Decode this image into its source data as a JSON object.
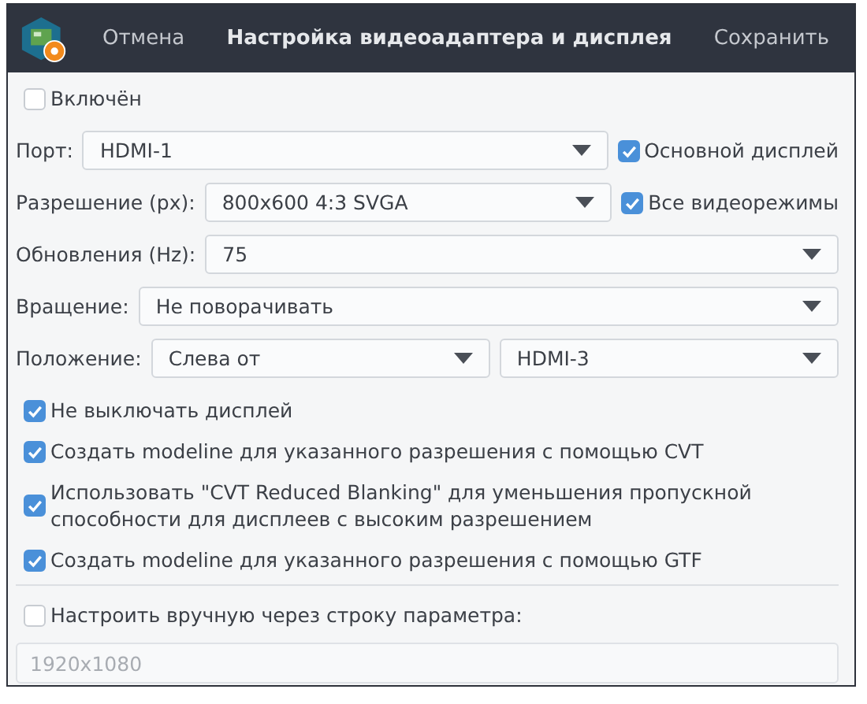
{
  "header": {
    "cancel": "Отмена",
    "title": "Настройка видеоадаптера и дисплея",
    "save": "Сохранить"
  },
  "enabled": {
    "label": "Включён",
    "checked": false
  },
  "rows": [
    {
      "kind": "combo_check",
      "label": "Порт:",
      "value": "HDMI-1",
      "check": {
        "label": "Основной дисплей",
        "checked": true
      }
    },
    {
      "kind": "combo_check",
      "label": "Разрешение (px):",
      "value": "800x600  4:3 SVGA",
      "check": {
        "label": "Все видеорежимы",
        "checked": true
      }
    },
    {
      "kind": "combo",
      "label": "Обновления (Hz):",
      "value": "75"
    },
    {
      "kind": "combo",
      "label": "Вращение:",
      "value": "Не поворачивать"
    },
    {
      "kind": "combo_pair",
      "label": "Положение:",
      "value": "Слева от",
      "value_2": "HDMI-3"
    }
  ],
  "options": [
    {
      "label": "Не выключать дисплей",
      "checked": true
    },
    {
      "label": "Создать modeline для указанного разрешения с помощью CVT",
      "checked": true
    },
    {
      "label": "Использовать \"CVT Reduced Blanking\" для уменьшения пропускной способности для дисплеев с высоким разрешением",
      "checked": true
    },
    {
      "label": "Создать modeline для указанного разрешения с помощью GTF",
      "checked": true
    }
  ],
  "manual": {
    "label": "Настроить вручную через строку параметра:",
    "checked": false,
    "placeholder": "1920x1080"
  }
}
